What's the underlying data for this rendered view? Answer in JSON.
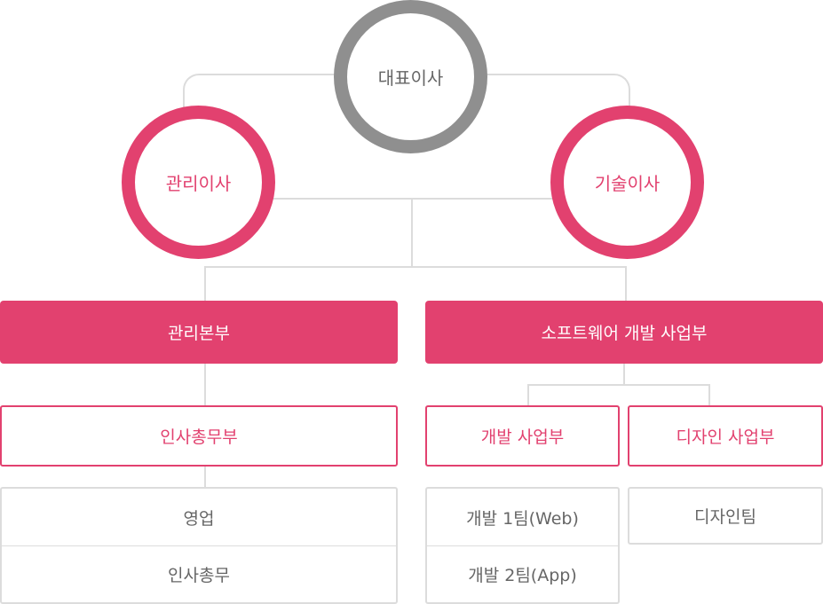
{
  "ceo": {
    "label": "대표이사"
  },
  "directors": {
    "admin": {
      "label": "관리이사"
    },
    "tech": {
      "label": "기술이사"
    }
  },
  "divisions": {
    "management": {
      "label": "관리본부"
    },
    "software": {
      "label": "소프트웨어 개발 사업부"
    }
  },
  "departments": {
    "hr_general": {
      "label": "인사총무부"
    },
    "development": {
      "label": "개발 사업부"
    },
    "design": {
      "label": "디자인 사업부"
    }
  },
  "teams": {
    "management": [
      "영업",
      "인사총무"
    ],
    "development": [
      "개발 1팀(Web)",
      "개발 2팀(App)"
    ],
    "design": [
      "디자인팀"
    ]
  },
  "colors": {
    "accent": "#e2416f",
    "ceo_ring": "#8f8f8f",
    "line": "#dcdcdc",
    "text_gray": "#666666"
  }
}
